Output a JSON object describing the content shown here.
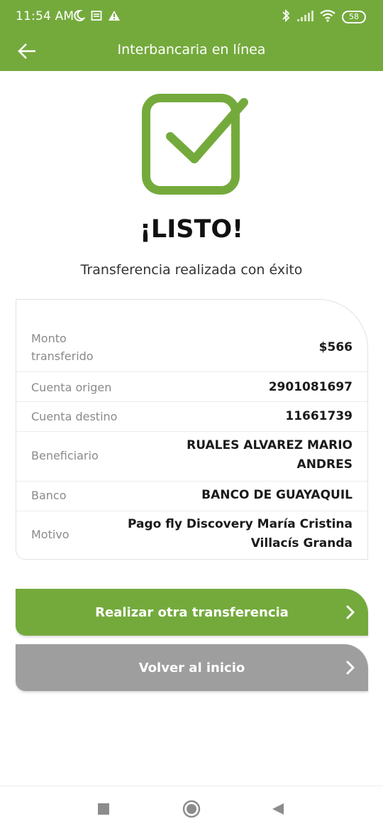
{
  "status_bar": {
    "time": "11:54 AM",
    "left_icons": [
      "moon-icon",
      "notification-icon",
      "warning-icon"
    ],
    "right_icons": [
      "bluetooth-icon",
      "signal-icon",
      "wifi-icon"
    ],
    "battery": "58"
  },
  "header": {
    "title": "Interbancaria en línea",
    "back_icon": "arrow-left-icon",
    "color": "#74aa3c"
  },
  "success": {
    "icon": "check-square-icon",
    "heading": "¡LISTO!",
    "message": "Transferencia realizada con éxito"
  },
  "details": {
    "rows": [
      {
        "label": "Monto transferido",
        "value": "$566"
      },
      {
        "label": "Cuenta origen",
        "value": "2901081697"
      },
      {
        "label": "Cuenta destino",
        "value": "11661739"
      },
      {
        "label": "Beneficiario",
        "value": "RUALES ALVAREZ MARIO ANDRES"
      },
      {
        "label": "Banco",
        "value": "BANCO DE GUAYAQUIL"
      },
      {
        "label": "Motivo",
        "value": "Pago fly Discovery María Cristina Villacís Granda"
      }
    ]
  },
  "actions": {
    "primary_label": "Realizar otra transferencia",
    "secondary_label": "Volver al inicio",
    "primary_color": "#74aa3c",
    "secondary_color": "#9e9e9e"
  },
  "system_nav": {
    "icons": [
      "recents-square-icon",
      "home-circle-icon",
      "back-triangle-icon"
    ]
  }
}
